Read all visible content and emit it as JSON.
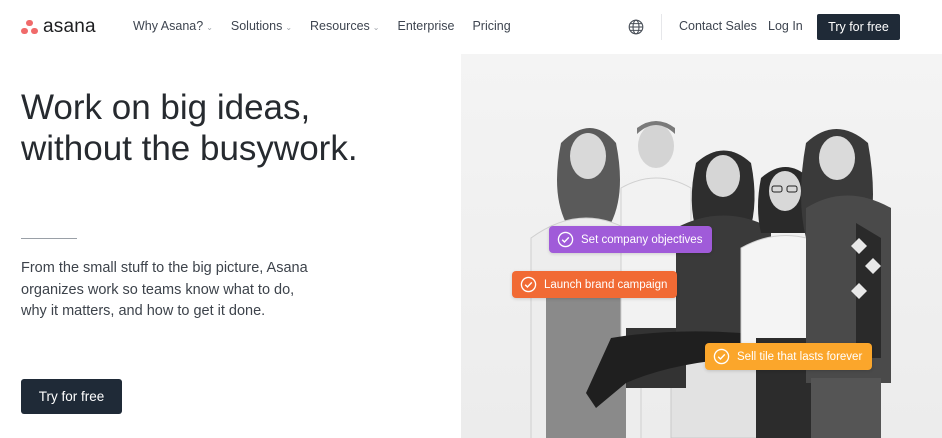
{
  "brand": {
    "name": "asana",
    "logo_color": "#f06a6a"
  },
  "nav": {
    "items": [
      {
        "label": "Why Asana?",
        "dropdown": true
      },
      {
        "label": "Solutions",
        "dropdown": true
      },
      {
        "label": "Resources",
        "dropdown": true
      },
      {
        "label": "Enterprise",
        "dropdown": false
      },
      {
        "label": "Pricing",
        "dropdown": false
      }
    ],
    "globe_icon": "globe-icon",
    "contact_sales": "Contact Sales",
    "log_in": "Log In",
    "cta": "Try for free"
  },
  "hero": {
    "title_line1": "Work on big ideas,",
    "title_line2": "without the busywork.",
    "description": "From the small stuff to the big picture, Asana organizes work so teams know what to do, why it matters, and how to get it done.",
    "cta": "Try for free"
  },
  "tasks": [
    {
      "label": "Set company objectives",
      "color": "#a05bd9"
    },
    {
      "label": "Launch brand campaign",
      "color": "#f16a34"
    },
    {
      "label": "Sell tile that lasts forever",
      "color": "#fba62b"
    }
  ],
  "colors": {
    "dark_button": "#1f2a37",
    "text": "#262a2f"
  }
}
